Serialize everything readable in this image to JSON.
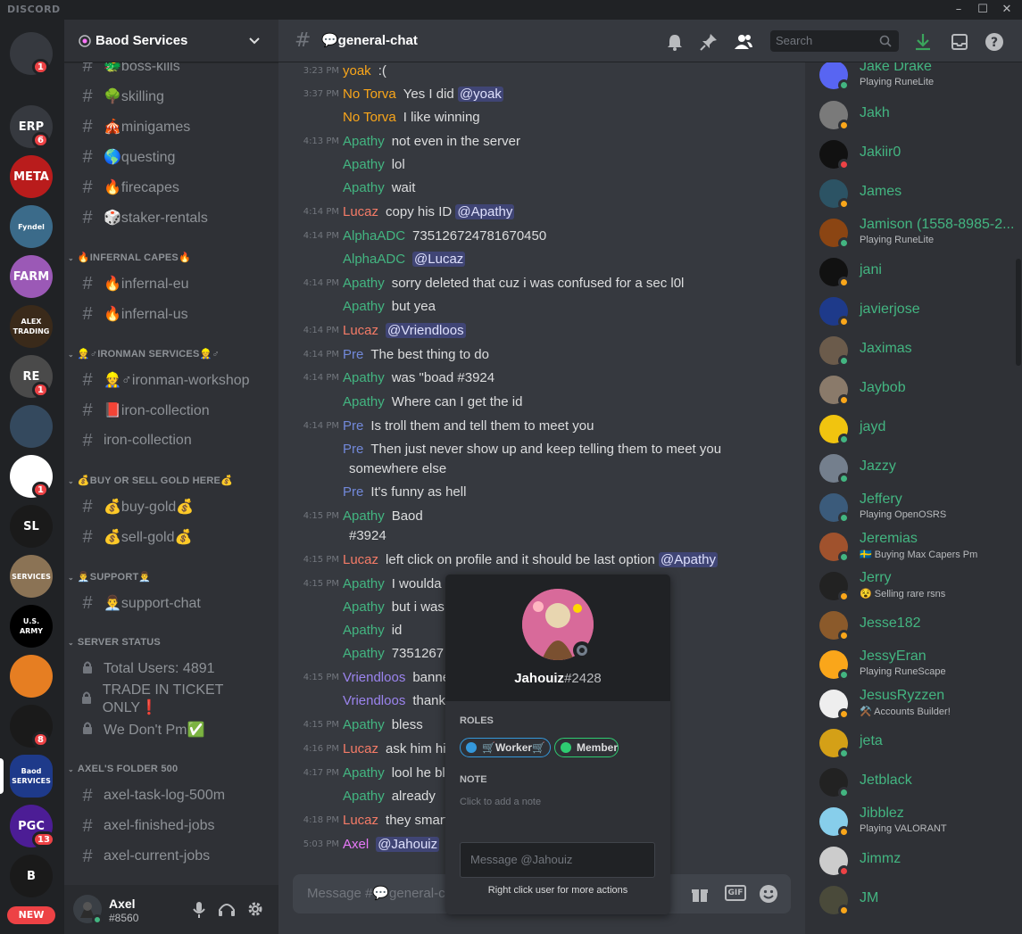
{
  "app": {
    "brand": "DISCORD"
  },
  "window": {
    "minimize": "–",
    "maximize": "☐",
    "close": "✕"
  },
  "guilds": {
    "items": [
      {
        "label": "",
        "color": "#36393f",
        "badge": "1"
      },
      {
        "label": "ERP",
        "color": "#36393f",
        "badge": "6"
      },
      {
        "label": "META",
        "color": "#b91c1c",
        "badge": ""
      },
      {
        "label": "Fyndel",
        "color": "#3b6b8a",
        "badge": ""
      },
      {
        "label": "FARM",
        "color": "#9b59b6",
        "badge": ""
      },
      {
        "label": "ALEX TRADING",
        "color": "#3a2a1a",
        "badge": ""
      },
      {
        "label": "RE",
        "color": "#4a4a4a",
        "badge": "1"
      },
      {
        "label": "",
        "color": "#34495e",
        "badge": ""
      },
      {
        "label": "",
        "color": "#ffffff",
        "badge": "1"
      },
      {
        "label": "SL",
        "color": "#1a1a1a",
        "badge": ""
      },
      {
        "label": "SERVICES",
        "color": "#8b7355",
        "badge": ""
      },
      {
        "label": "U.S. ARMY",
        "color": "#000000",
        "badge": ""
      },
      {
        "label": "",
        "color": "#e67e22",
        "badge": ""
      },
      {
        "label": "",
        "color": "#1a1a1a",
        "badge": "8"
      },
      {
        "label": "Baod SERVICES",
        "color": "#1e3a8a",
        "badge": ""
      },
      {
        "label": "PGC",
        "color": "#4c1d95",
        "badge": "13"
      },
      {
        "label": "B",
        "color": "#1a1a1a",
        "badge": ""
      }
    ],
    "new_label": "NEW"
  },
  "server": {
    "name": "Baod Services"
  },
  "channels": [
    {
      "type": "channel",
      "label": "🐲boss-kills"
    },
    {
      "type": "channel",
      "label": "🌳skilling"
    },
    {
      "type": "channel",
      "label": "🎪minigames"
    },
    {
      "type": "channel",
      "label": "🌎questing"
    },
    {
      "type": "channel",
      "label": "🔥firecapes"
    },
    {
      "type": "channel",
      "label": "🎲staker-rentals"
    },
    {
      "type": "category",
      "label": "🔥INFERNAL CAPES🔥"
    },
    {
      "type": "channel",
      "label": "🔥infernal-eu"
    },
    {
      "type": "channel",
      "label": "🔥infernal-us"
    },
    {
      "type": "category",
      "label": "👷♂IRONMAN SERVICES👷♂"
    },
    {
      "type": "channel",
      "label": "👷♂ironman-workshop"
    },
    {
      "type": "channel",
      "label": "📕iron-collection"
    },
    {
      "type": "channel",
      "label": "iron-collection"
    },
    {
      "type": "category",
      "label": "💰BUY OR SELL GOLD HERE💰"
    },
    {
      "type": "channel",
      "label": "💰buy-gold💰"
    },
    {
      "type": "channel",
      "label": "💰sell-gold💰"
    },
    {
      "type": "category",
      "label": "👨‍💼SUPPORT👨‍💼"
    },
    {
      "type": "channel",
      "label": "👨‍💼support-chat"
    },
    {
      "type": "category",
      "label": "SERVER STATUS"
    },
    {
      "type": "locked",
      "label": "Total Users: 4891"
    },
    {
      "type": "locked",
      "label": "TRADE IN TICKET ONLY❗"
    },
    {
      "type": "locked",
      "label": "We Don't Pm✅"
    },
    {
      "type": "category",
      "label": "AXEL'S FOLDER 500"
    },
    {
      "type": "channel",
      "label": "axel-task-log-500m"
    },
    {
      "type": "channel",
      "label": "axel-finished-jobs"
    },
    {
      "type": "channel",
      "label": "axel-current-jobs"
    }
  ],
  "user": {
    "name": "Axel",
    "tag": "#8560"
  },
  "chat": {
    "channel_name": "💬general-chat",
    "search_placeholder": "Search",
    "composer_placeholder": "Message #💬general-chat"
  },
  "messages": [
    {
      "time": "3:23 PM",
      "author": "yoak",
      "color": "#faa61a",
      "segments": [
        {
          "t": ":("
        }
      ]
    },
    {
      "time": "3:37 PM",
      "author": "No Torva",
      "color": "#faa61a",
      "segments": [
        {
          "t": "Yes I did "
        },
        {
          "t": "@yoak",
          "m": true
        }
      ]
    },
    {
      "time": "",
      "author": "No Torva",
      "color": "#faa61a",
      "segments": [
        {
          "t": "I like winning"
        }
      ]
    },
    {
      "time": "4:13 PM",
      "author": "Apathy",
      "color": "#43b581",
      "segments": [
        {
          "t": "not even in the server"
        }
      ]
    },
    {
      "time": "",
      "author": "Apathy",
      "color": "#43b581",
      "segments": [
        {
          "t": "lol"
        }
      ]
    },
    {
      "time": "",
      "author": "Apathy",
      "color": "#43b581",
      "segments": [
        {
          "t": "wait"
        }
      ]
    },
    {
      "time": "4:14 PM",
      "author": "Lucaz",
      "color": "#f47b67",
      "segments": [
        {
          "t": "copy his ID "
        },
        {
          "t": "@Apathy",
          "m": true
        }
      ]
    },
    {
      "time": "4:14 PM",
      "author": "AlphaADC",
      "color": "#43b581",
      "segments": [
        {
          "t": "735126724781670450"
        }
      ]
    },
    {
      "time": "",
      "author": "AlphaADC",
      "color": "#43b581",
      "segments": [
        {
          "t": "@Lucaz",
          "m": true
        }
      ]
    },
    {
      "time": "4:14 PM",
      "author": "Apathy",
      "color": "#43b581",
      "segments": [
        {
          "t": "sorry deleted that cuz i was confused for a sec l0l"
        }
      ]
    },
    {
      "time": "",
      "author": "Apathy",
      "color": "#43b581",
      "segments": [
        {
          "t": "but yea"
        }
      ]
    },
    {
      "time": "4:14 PM",
      "author": "Lucaz",
      "color": "#f47b67",
      "segments": [
        {
          "t": "@Vriendloos",
          "m": true
        }
      ]
    },
    {
      "time": "4:14 PM",
      "author": "Pre",
      "color": "#7289da",
      "segments": [
        {
          "t": "The best thing to do"
        }
      ]
    },
    {
      "time": "4:14 PM",
      "author": "Apathy",
      "color": "#43b581",
      "segments": [
        {
          "t": "was \"boad #3924"
        }
      ]
    },
    {
      "time": "",
      "author": "Apathy",
      "color": "#43b581",
      "segments": [
        {
          "t": "Where can I get the id"
        }
      ]
    },
    {
      "time": "4:14 PM",
      "author": "Pre",
      "color": "#7289da",
      "segments": [
        {
          "t": "Is troll them and tell them to meet you"
        }
      ]
    },
    {
      "time": "",
      "author": "Pre",
      "color": "#7289da",
      "segments": [
        {
          "t": "Then just never show up and keep telling them to meet you"
        }
      ],
      "cont": "somewhere else"
    },
    {
      "time": "",
      "author": "Pre",
      "color": "#7289da",
      "segments": [
        {
          "t": "It's funny as hell"
        }
      ]
    },
    {
      "time": "4:15 PM",
      "author": "Apathy",
      "color": "#43b581",
      "segments": [
        {
          "t": "Baod"
        }
      ],
      "cont": "#3924"
    },
    {
      "time": "4:15 PM",
      "author": "Lucaz",
      "color": "#f47b67",
      "segments": [
        {
          "t": "left click on profile and it should be last option "
        },
        {
          "t": "@Apathy",
          "m": true
        }
      ]
    },
    {
      "time": "4:15 PM",
      "author": "Apathy",
      "color": "#43b581",
      "segments": [
        {
          "t": "I woulda"
        }
      ]
    },
    {
      "time": "",
      "author": "Apathy",
      "color": "#43b581",
      "segments": [
        {
          "t": "but i was"
        }
      ]
    },
    {
      "time": "",
      "author": "Apathy",
      "color": "#43b581",
      "segments": [
        {
          "t": "id"
        }
      ]
    },
    {
      "time": "",
      "author": "Apathy",
      "color": "#43b581",
      "segments": [
        {
          "t": "7351267"
        }
      ]
    },
    {
      "time": "4:15 PM",
      "author": "Vriendloos",
      "color": "#9b84ee",
      "segments": [
        {
          "t": "banne"
        }
      ]
    },
    {
      "time": "",
      "author": "Vriendloos",
      "color": "#9b84ee",
      "segments": [
        {
          "t": "thank"
        }
      ]
    },
    {
      "time": "4:15 PM",
      "author": "Apathy",
      "color": "#43b581",
      "segments": [
        {
          "t": "bless"
        }
      ]
    },
    {
      "time": "4:16 PM",
      "author": "Lucaz",
      "color": "#f47b67",
      "segments": [
        {
          "t": "ask him his"
        }
      ]
    },
    {
      "time": "4:17 PM",
      "author": "Apathy",
      "color": "#43b581",
      "segments": [
        {
          "t": "lool he bl"
        }
      ]
    },
    {
      "time": "",
      "author": "Apathy",
      "color": "#43b581",
      "segments": [
        {
          "t": "already"
        }
      ]
    },
    {
      "time": "4:18 PM",
      "author": "Lucaz",
      "color": "#f47b67",
      "segments": [
        {
          "t": "they smart"
        }
      ]
    },
    {
      "time": "5:03 PM",
      "author": "Axel",
      "color": "#e879f9",
      "segments": [
        {
          "t": "@Jahouiz",
          "m": true
        }
      ]
    }
  ],
  "members": [
    {
      "name": "Jake Drake",
      "activity": "Playing RuneLite",
      "status": "#43b581",
      "av": "#5865f2"
    },
    {
      "name": "Jakh",
      "activity": "",
      "status": "#faa61a",
      "av": "#7a7a7a"
    },
    {
      "name": "Jakiir0",
      "activity": "",
      "status": "#ed4245",
      "av": "#111111"
    },
    {
      "name": "James",
      "activity": "",
      "status": "#faa61a",
      "av": "#2c5364"
    },
    {
      "name": "Jamison (1558-8985-2...",
      "activity": "Playing RuneLite",
      "status": "#43b581",
      "av": "#8b4513"
    },
    {
      "name": "jani",
      "activity": "",
      "status": "#faa61a",
      "av": "#111111"
    },
    {
      "name": "javierjose",
      "activity": "",
      "status": "#faa61a",
      "av": "#1e3a8a"
    },
    {
      "name": "Jaximas",
      "activity": "",
      "status": "#43b581",
      "av": "#6b5b4b"
    },
    {
      "name": "Jaybob",
      "activity": "",
      "status": "#faa61a",
      "av": "#8a7a6a"
    },
    {
      "name": "jayd",
      "activity": "",
      "status": "#43b581",
      "av": "#f1c40f"
    },
    {
      "name": "Jazzy",
      "activity": "",
      "status": "#43b581",
      "av": "#747f8d"
    },
    {
      "name": "Jeffery",
      "activity": "Playing OpenOSRS",
      "status": "#43b581",
      "av": "#3b5b7b"
    },
    {
      "name": "Jeremias",
      "activity": "🇸🇪 Buying Max Capers Pm",
      "status": "#43b581",
      "av": "#a0522d"
    },
    {
      "name": "Jerry",
      "activity": "😵 Selling rare rsns",
      "status": "#faa61a",
      "av": "#222222"
    },
    {
      "name": "Jesse182",
      "activity": "",
      "status": "#faa61a",
      "av": "#8b5a2b"
    },
    {
      "name": "JessyEran",
      "activity": "Playing RuneScape",
      "status": "#43b581",
      "av": "#faa61a"
    },
    {
      "name": "JesusRyzzen",
      "activity": "⚒️ Accounts Builder!",
      "status": "#faa61a",
      "av": "#eeeeee"
    },
    {
      "name": "jeta",
      "activity": "",
      "status": "#43b581",
      "av": "#d4a017"
    },
    {
      "name": "Jetblack",
      "activity": "",
      "status": "#43b581",
      "av": "#222222"
    },
    {
      "name": "Jibblez",
      "activity": "Playing VALORANT",
      "status": "#faa61a",
      "av": "#87ceeb"
    },
    {
      "name": "Jimmz",
      "activity": "",
      "status": "#ed4245",
      "av": "#cccccc"
    },
    {
      "name": "JM",
      "activity": "",
      "status": "#faa61a",
      "av": "#4a4a3a"
    }
  ],
  "popout": {
    "username": "Jahouiz",
    "discriminator": "#2428",
    "roles_heading": "ROLES",
    "roles": [
      {
        "label": "🛒Worker🛒",
        "color": "#3498db"
      },
      {
        "label": "Member",
        "color": "#2ecc71"
      }
    ],
    "note_heading": "NOTE",
    "note_placeholder": "Click to add a note",
    "message_placeholder": "Message @Jahouiz",
    "hint": "Right click user for more actions"
  }
}
